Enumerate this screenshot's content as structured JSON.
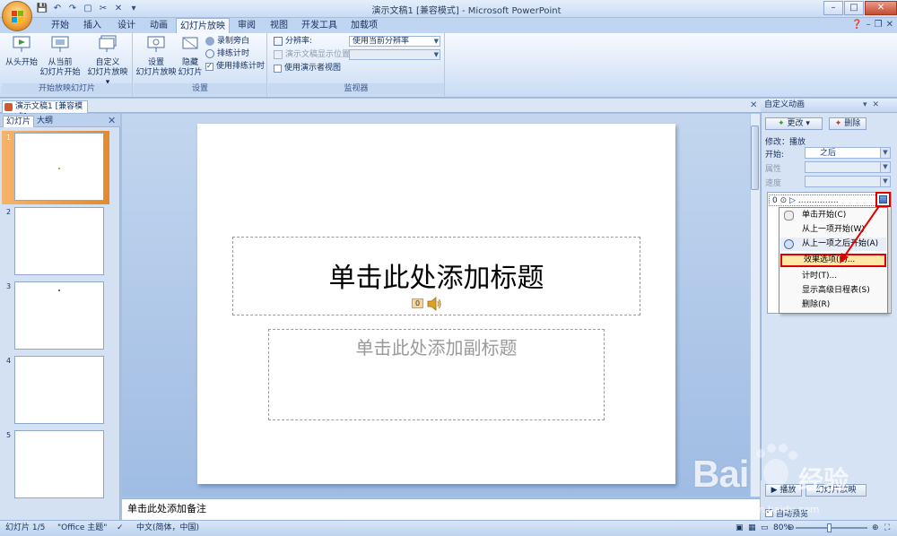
{
  "window": {
    "title": "演示文稿1 [兼容模式] - Microsoft PowerPoint",
    "controls": [
      "–",
      "□",
      "✕"
    ]
  },
  "tabs": [
    "开始",
    "插入",
    "设计",
    "动画",
    "幻灯片放映",
    "审阅",
    "视图",
    "开发工具",
    "加载项"
  ],
  "active_tab": "幻灯片放映",
  "ribbon": {
    "group_start": {
      "label": "开始放映幻灯片",
      "from_start": "从头开始",
      "from_current_1": "从当前",
      "from_current_2": "幻灯片开始",
      "custom_1": "自定义",
      "custom_2": "幻灯片放映 ▾"
    },
    "group_setup": {
      "label": "设置",
      "setup_1": "设置",
      "setup_2": "幻灯片放映",
      "hide_1": "隐藏",
      "hide_2": "幻灯片",
      "record": "录制旁白",
      "rehearse": "排练计时",
      "use_timings": "使用排练计时"
    },
    "group_monitors": {
      "label": "监视器",
      "resolution_label": "分辨率:",
      "resolution_value": "使用当前分辨率",
      "show_on_label": "演示文稿显示位置:",
      "presenter_view": "使用演示者视图"
    }
  },
  "document": {
    "tab": "演示文稿1 [兼容模式]"
  },
  "left_panel": {
    "tab_slides": "幻灯片",
    "tab_outline": "大纲",
    "slide_numbers": [
      "1",
      "2",
      "3",
      "4",
      "5"
    ]
  },
  "slide": {
    "title_placeholder": "单击此处添加标题",
    "subtitle_placeholder": "单击此处添加副标题",
    "anim_tag": "0"
  },
  "notes": {
    "placeholder": "单击此处添加备注"
  },
  "task_pane": {
    "title": "自定义动画",
    "change_btn": "更改 ▾",
    "remove_btn": "删除",
    "modify_label": "修改：播放",
    "start_label": "开始:",
    "start_value": "之后",
    "property_label": "属性",
    "speed_label": "速度",
    "anim_item": "0 ⊙  ▷  ……………",
    "play_btn": "▶ 播放",
    "slideshow_btn": "幻灯片放映",
    "autopreview": "自动预览"
  },
  "context_menu": {
    "items": [
      "单击开始(C)",
      "从上一项开始(W)",
      "从上一项之后开始(A)",
      "效果选项(E)...",
      "计时(T)...",
      "显示高级日程表(S)",
      "删除(R)"
    ],
    "highlighted": "效果选项(E)..."
  },
  "status": {
    "slide_info": "幻灯片 1/5",
    "theme": "\"Office 主题\"",
    "language": "中文(简体，中国)",
    "zoom": "80%"
  },
  "watermark": {
    "brand": "Bai",
    "cn": "经验",
    "url": "jingyan.baidu.com"
  },
  "colors": {
    "highlight_red": "#e00000",
    "ribbon_blue": "#c9dcf4",
    "selected_thumb": "#e38a2b"
  }
}
